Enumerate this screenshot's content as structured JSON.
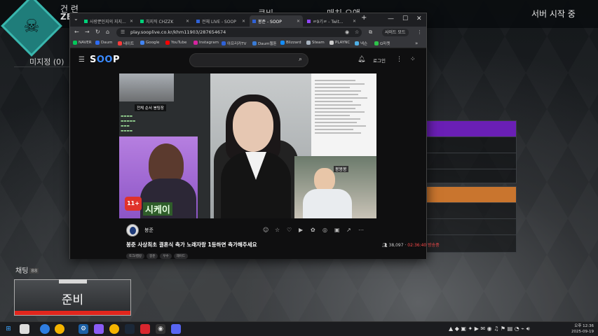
{
  "game": {
    "header_left": "건 련",
    "header_left2": "ZE",
    "header_mid1": "큐비",
    "header_mid2": "매치 오앤",
    "header_right": "서버 시작 중",
    "unassigned": "미지정 (0)",
    "chat_label": "채팅",
    "chat_badge": "88",
    "ready": "준비",
    "colors": {
      "accent_teal": "#39b6ad",
      "ready_red": "#e2261d",
      "purple_bar": "#6a1fb5",
      "orange_bar": "#c9752e"
    }
  },
  "browser": {
    "tabs": [
      {
        "label": "사랑뿐인지의 지지...",
        "icon": "chzzk-icon",
        "active": false
      },
      {
        "label": "치지직 CHZZK",
        "icon": "chzzk-icon",
        "active": false
      },
      {
        "label": "전체 LIVE - SOOP",
        "icon": "soop-icon",
        "active": false
      },
      {
        "label": "봉준 - SOOP",
        "icon": "soop-icon",
        "active": true
      },
      {
        "label": "ㄹ9기ㄹ - Twit...",
        "icon": "twitch-icon",
        "active": false
      }
    ],
    "url": "play.sooplive.co.kr/khm11903/287654674",
    "side_mode": "사이드 모드",
    "bookmarks": [
      {
        "label": "NAVER",
        "color": "#03c75a"
      },
      {
        "label": "Daum",
        "color": "#2d6cf5"
      },
      {
        "label": "네이트",
        "color": "#ff3b3b"
      },
      {
        "label": "Google",
        "color": "#4285f4"
      },
      {
        "label": "YouTube",
        "color": "#ff0000"
      },
      {
        "label": "Instagram",
        "color": "#d6249f"
      },
      {
        "label": "아프리카TV",
        "color": "#2f62d8"
      },
      {
        "label": "Daum웹툰",
        "color": "#3a7bd5"
      },
      {
        "label": "Blizzard",
        "color": "#148eff"
      },
      {
        "label": "Steam",
        "color": "#a8b4c0"
      },
      {
        "label": "PLAYNC",
        "color": "#cccccc"
      },
      {
        "label": "넥슨",
        "color": "#4fb0e6"
      },
      {
        "label": "G마켓",
        "color": "#2ec44a"
      }
    ]
  },
  "soop": {
    "logo_s": "S",
    "logo_oo": "OO",
    "logo_p": "P",
    "login": "로그인",
    "streamer": "봉준",
    "title": "봉준 사상최초 결혼식 축가 노래자랑 1등하면 축가해주세요",
    "viewers": "38,097",
    "uptime": "02:36:40",
    "status": "방송중",
    "tags": [
      "토크/캠방",
      "봉준",
      "우수",
      "레이드"
    ],
    "video": {
      "cam_label": "전체 순서",
      "cam_label2": "봉팀장",
      "badge": "11+",
      "sign": "시케이",
      "right_cam_text": "봉봉봉"
    }
  },
  "taskbar": {
    "clock_time": "오후 12:36",
    "clock_date": "2025-09-19"
  }
}
